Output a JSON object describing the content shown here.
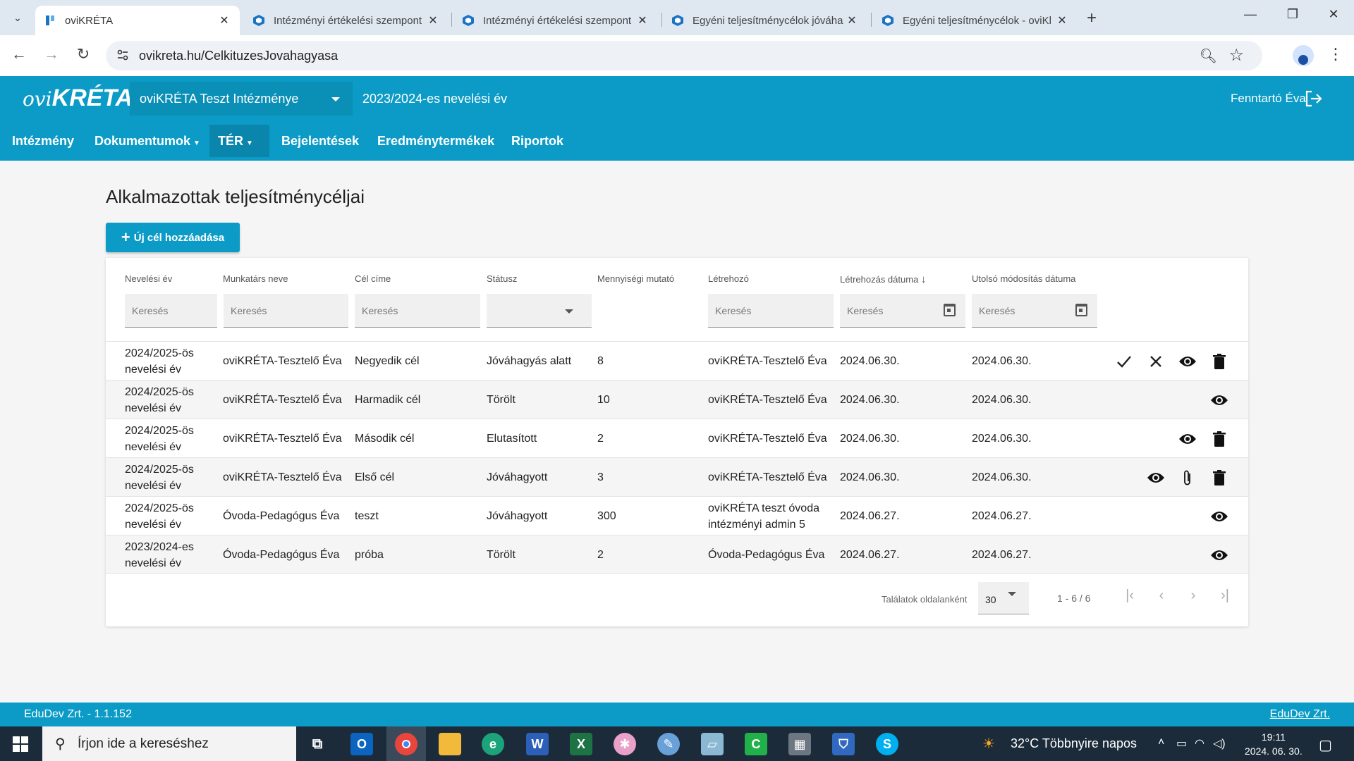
{
  "browser": {
    "tabs": [
      {
        "title": "oviKRÉTA",
        "active": true
      },
      {
        "title": "Intézményi értékelési szempont",
        "active": false
      },
      {
        "title": "Intézményi értékelési szempont",
        "active": false
      },
      {
        "title": "Egyéni teljesítménycélok jóváha",
        "active": false
      },
      {
        "title": "Egyéni teljesítménycélok - oviKl",
        "active": false
      }
    ],
    "url": "ovikreta.hu/CelkituzesJovahagyasa"
  },
  "header": {
    "logo_ovi": "ovi",
    "logo_kreta": "KRÉTA",
    "institution": "oviKRÉTA Teszt Intézménye",
    "school_year": "2023/2024-es nevelési év",
    "user": "Fenntartó Éva"
  },
  "nav": {
    "items": [
      "Intézmény",
      "Dokumentumok",
      "TÉR",
      "Bejelentések",
      "Eredménytermékek",
      "Riportok"
    ]
  },
  "page": {
    "title": "Alkalmazottak teljesítménycéljai",
    "add_button": "Új cél hozzáadása"
  },
  "table": {
    "columns": [
      "Nevelési év",
      "Munkatárs neve",
      "Cél címe",
      "Státusz",
      "Mennyiségi mutató",
      "Létrehozó",
      "Létrehozás dátuma",
      "Utolsó módosítás dátuma"
    ],
    "search_placeholder": "Keresés",
    "sort_column": "Létrehozás dátuma",
    "sort_direction": "desc",
    "rows": [
      {
        "year1": "2024/2025-ös",
        "year2": "nevelési év",
        "name": "oviKRÉTA-Tesztelő Éva",
        "goal": "Negyedik cél",
        "status": "Jóváhagyás alatt",
        "qty": "8",
        "creator1": "oviKRÉTA-Tesztelő Éva",
        "creator2": "",
        "created": "2024.06.30.",
        "modified": "2024.06.30.",
        "actions": [
          "check-icon",
          "close-icon",
          "eye-icon",
          "trash-icon"
        ]
      },
      {
        "year1": "2024/2025-ös",
        "year2": "nevelési év",
        "name": "oviKRÉTA-Tesztelő Éva",
        "goal": "Harmadik cél",
        "status": "Törölt",
        "qty": "10",
        "creator1": "oviKRÉTA-Tesztelő Éva",
        "creator2": "",
        "created": "2024.06.30.",
        "modified": "2024.06.30.",
        "actions": [
          "eye-icon"
        ]
      },
      {
        "year1": "2024/2025-ös",
        "year2": "nevelési év",
        "name": "oviKRÉTA-Tesztelő Éva",
        "goal": "Második cél",
        "status": "Elutasított",
        "qty": "2",
        "creator1": "oviKRÉTA-Tesztelő Éva",
        "creator2": "",
        "created": "2024.06.30.",
        "modified": "2024.06.30.",
        "actions": [
          "eye-icon",
          "trash-icon"
        ]
      },
      {
        "year1": "2024/2025-ös",
        "year2": "nevelési év",
        "name": "oviKRÉTA-Tesztelő Éva",
        "goal": "Első cél",
        "status": "Jóváhagyott",
        "qty": "3",
        "creator1": "oviKRÉTA-Tesztelő Éva",
        "creator2": "",
        "created": "2024.06.30.",
        "modified": "2024.06.30.",
        "actions": [
          "eye-icon",
          "paperclip-icon",
          "trash-icon"
        ]
      },
      {
        "year1": "2024/2025-ös",
        "year2": "nevelési év",
        "name": "Óvoda-Pedagógus Éva",
        "goal": "teszt",
        "status": "Jóváhagyott",
        "qty": "300",
        "creator1": "oviKRÉTA teszt óvoda",
        "creator2": "intézményi admin 5",
        "created": "2024.06.27.",
        "modified": "2024.06.27.",
        "actions": [
          "eye-icon"
        ]
      },
      {
        "year1": "2023/2024-es",
        "year2": "nevelési év",
        "name": "Óvoda-Pedagógus Éva",
        "goal": "próba",
        "status": "Törölt",
        "qty": "2",
        "creator1": "Óvoda-Pedagógus Éva",
        "creator2": "",
        "created": "2024.06.27.",
        "modified": "2024.06.27.",
        "actions": [
          "eye-icon"
        ]
      }
    ]
  },
  "pager": {
    "per_page_label": "Találatok oldalanként",
    "per_page": "30",
    "range": "1 - 6 / 6"
  },
  "footer": {
    "left": "EduDev Zrt. - 1.1.152",
    "right": "EduDev Zrt."
  },
  "taskbar": {
    "search_placeholder": "Írjon ide a kereséshez",
    "weather": "32°C  Többnyire napos",
    "time": "19:11",
    "date": "2024. 06. 30."
  },
  "colors": {
    "brand": "#0b9bc6",
    "brand_dark": "#0a86ad"
  }
}
